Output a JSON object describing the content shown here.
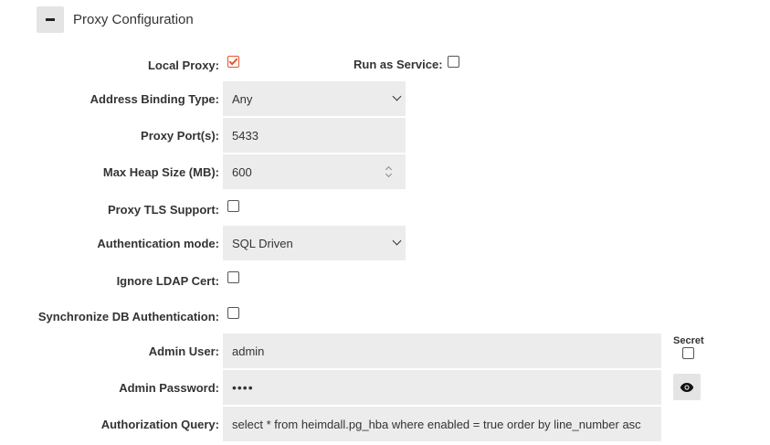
{
  "section": {
    "title": "Proxy Configuration"
  },
  "form": {
    "local_proxy": {
      "label": "Local Proxy:",
      "checked": true
    },
    "run_as_service": {
      "label": "Run as Service:",
      "checked": false
    },
    "address_binding_type": {
      "label": "Address Binding Type:",
      "value": "Any"
    },
    "proxy_ports": {
      "label": "Proxy Port(s):",
      "value": "5433"
    },
    "max_heap_size": {
      "label": "Max Heap Size (MB):",
      "value": "600"
    },
    "proxy_tls_support": {
      "label": "Proxy TLS Support:",
      "checked": false
    },
    "authentication_mode": {
      "label": "Authentication mode:",
      "value": "SQL Driven"
    },
    "ignore_ldap_cert": {
      "label": "Ignore LDAP Cert:",
      "checked": false
    },
    "sync_db_auth": {
      "label": "Synchronize DB Authentication:",
      "checked": false
    },
    "admin_user": {
      "label": "Admin User:",
      "value": "admin"
    },
    "secret": {
      "label": "Secret",
      "checked": false
    },
    "admin_password": {
      "label": "Admin Password:",
      "value": "••••"
    },
    "authorization_query": {
      "label": "Authorization Query:",
      "value": "select * from heimdall.pg_hba where enabled = true order by line_number asc"
    }
  },
  "colors": {
    "accent": "#e4572e",
    "field_bg": "#ececec",
    "button_bg": "#e4e4e4"
  },
  "icons": {
    "collapse": "minus-icon",
    "reveal": "eye-icon"
  }
}
